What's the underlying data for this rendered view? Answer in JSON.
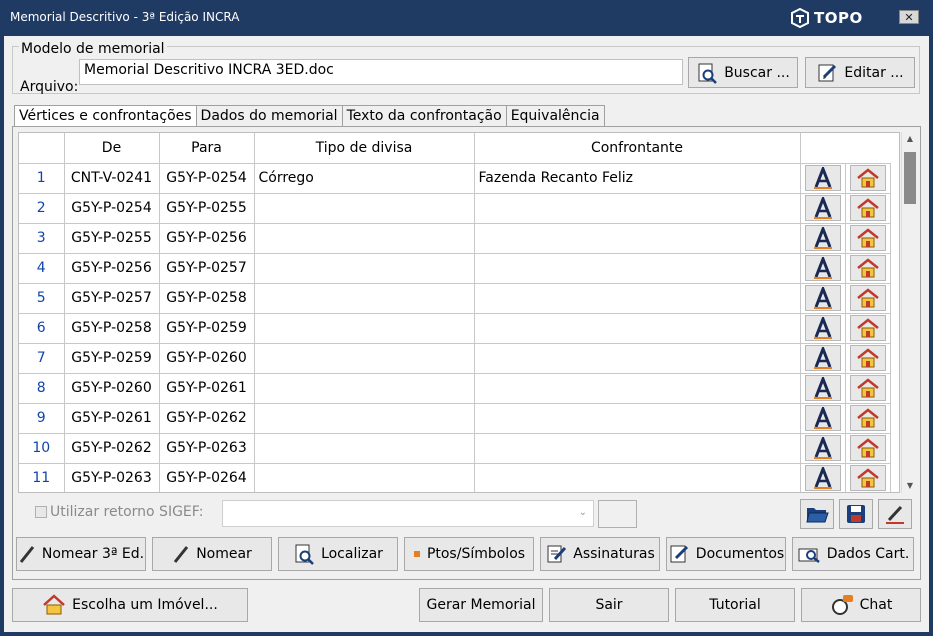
{
  "window": {
    "title": "Memorial Descritivo - 3ª Edição INCRA",
    "brand": "TOPO",
    "close_glyph": "✕"
  },
  "modelo": {
    "legend": "Modelo de memorial",
    "arquivo_label": "Arquivo:",
    "arquivo_value": "Memorial Descritivo INCRA 3ED.doc",
    "buscar_label": "Buscar ...",
    "editar_label": "Editar ..."
  },
  "tabs": [
    {
      "label": "Vértices e confrontações",
      "active": true
    },
    {
      "label": "Dados do memorial",
      "active": false
    },
    {
      "label": "Texto da confrontação",
      "active": false
    },
    {
      "label": "Equivalência",
      "active": false
    }
  ],
  "grid": {
    "columns": [
      "",
      "De",
      "Para",
      "Tipo de divisa",
      "Confrontante"
    ],
    "rows": [
      {
        "n": "1",
        "de": "CNT-V-0241",
        "para": "G5Y-P-0254",
        "tipo": "Córrego",
        "confrontante": "Fazenda Recanto Feliz"
      },
      {
        "n": "2",
        "de": "G5Y-P-0254",
        "para": "G5Y-P-0255",
        "tipo": "",
        "confrontante": ""
      },
      {
        "n": "3",
        "de": "G5Y-P-0255",
        "para": "G5Y-P-0256",
        "tipo": "",
        "confrontante": ""
      },
      {
        "n": "4",
        "de": "G5Y-P-0256",
        "para": "G5Y-P-0257",
        "tipo": "",
        "confrontante": ""
      },
      {
        "n": "5",
        "de": "G5Y-P-0257",
        "para": "G5Y-P-0258",
        "tipo": "",
        "confrontante": ""
      },
      {
        "n": "6",
        "de": "G5Y-P-0258",
        "para": "G5Y-P-0259",
        "tipo": "",
        "confrontante": ""
      },
      {
        "n": "7",
        "de": "G5Y-P-0259",
        "para": "G5Y-P-0260",
        "tipo": "",
        "confrontante": ""
      },
      {
        "n": "8",
        "de": "G5Y-P-0260",
        "para": "G5Y-P-0261",
        "tipo": "",
        "confrontante": ""
      },
      {
        "n": "9",
        "de": "G5Y-P-0261",
        "para": "G5Y-P-0262",
        "tipo": "",
        "confrontante": ""
      },
      {
        "n": "10",
        "de": "G5Y-P-0262",
        "para": "G5Y-P-0263",
        "tipo": "",
        "confrontante": ""
      },
      {
        "n": "11",
        "de": "G5Y-P-0263",
        "para": "G5Y-P-0264",
        "tipo": "",
        "confrontante": ""
      }
    ],
    "scroll_up_glyph": "▲",
    "scroll_down_glyph": "▼"
  },
  "sigef": {
    "label": "Utilizar retorno SIGEF:",
    "select_arrow": "⌄"
  },
  "tools": {
    "nomear3": "Nomear 3ª Ed.",
    "nomear": "Nomear",
    "localizar": "Localizar",
    "ptos": "Ptos/Símbolos",
    "assinaturas": "Assinaturas",
    "documentos": "Documentos",
    "dados_cart": "Dados Cart."
  },
  "bottom": {
    "escolha": "Escolha um Imóvel...",
    "gerar": "Gerar Memorial",
    "sair": "Sair",
    "tutorial": "Tutorial",
    "chat": "Chat"
  },
  "icons": {
    "row_letter_icon": "letter-a-icon",
    "row_house_icon": "house-icon",
    "accent": "#1f3a63"
  }
}
